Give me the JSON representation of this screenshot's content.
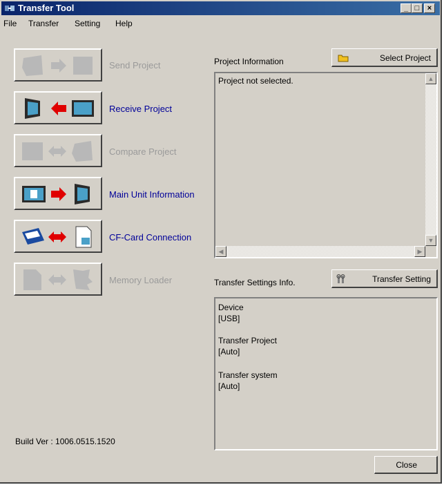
{
  "window": {
    "title": "Transfer Tool"
  },
  "menu": [
    "File",
    "Transfer",
    "Setting",
    "Help"
  ],
  "actions": {
    "send": "Send Project",
    "receive": "Receive Project",
    "compare": "Compare Project",
    "main_unit": "Main Unit Information",
    "cf_card": "CF-Card Connection",
    "memory_loader": "Memory Loader"
  },
  "project_info": {
    "label": "Project Information",
    "select_button": "Select Project",
    "text": "Project not selected."
  },
  "transfer_settings": {
    "label": "Transfer Settings Info.",
    "button": "Transfer Setting",
    "device_label": "Device",
    "device_value": "[USB]",
    "project_label": "Transfer Project",
    "project_value": "[Auto]",
    "system_label": "Transfer system",
    "system_value": "[Auto]"
  },
  "build": "Build Ver : 1006.0515.1520",
  "close_button": "Close",
  "colors": {
    "titlebar": "#0a246a",
    "enabled_link": "#000099",
    "disabled": "#9a9a9a",
    "face": "#d4d0c8"
  }
}
